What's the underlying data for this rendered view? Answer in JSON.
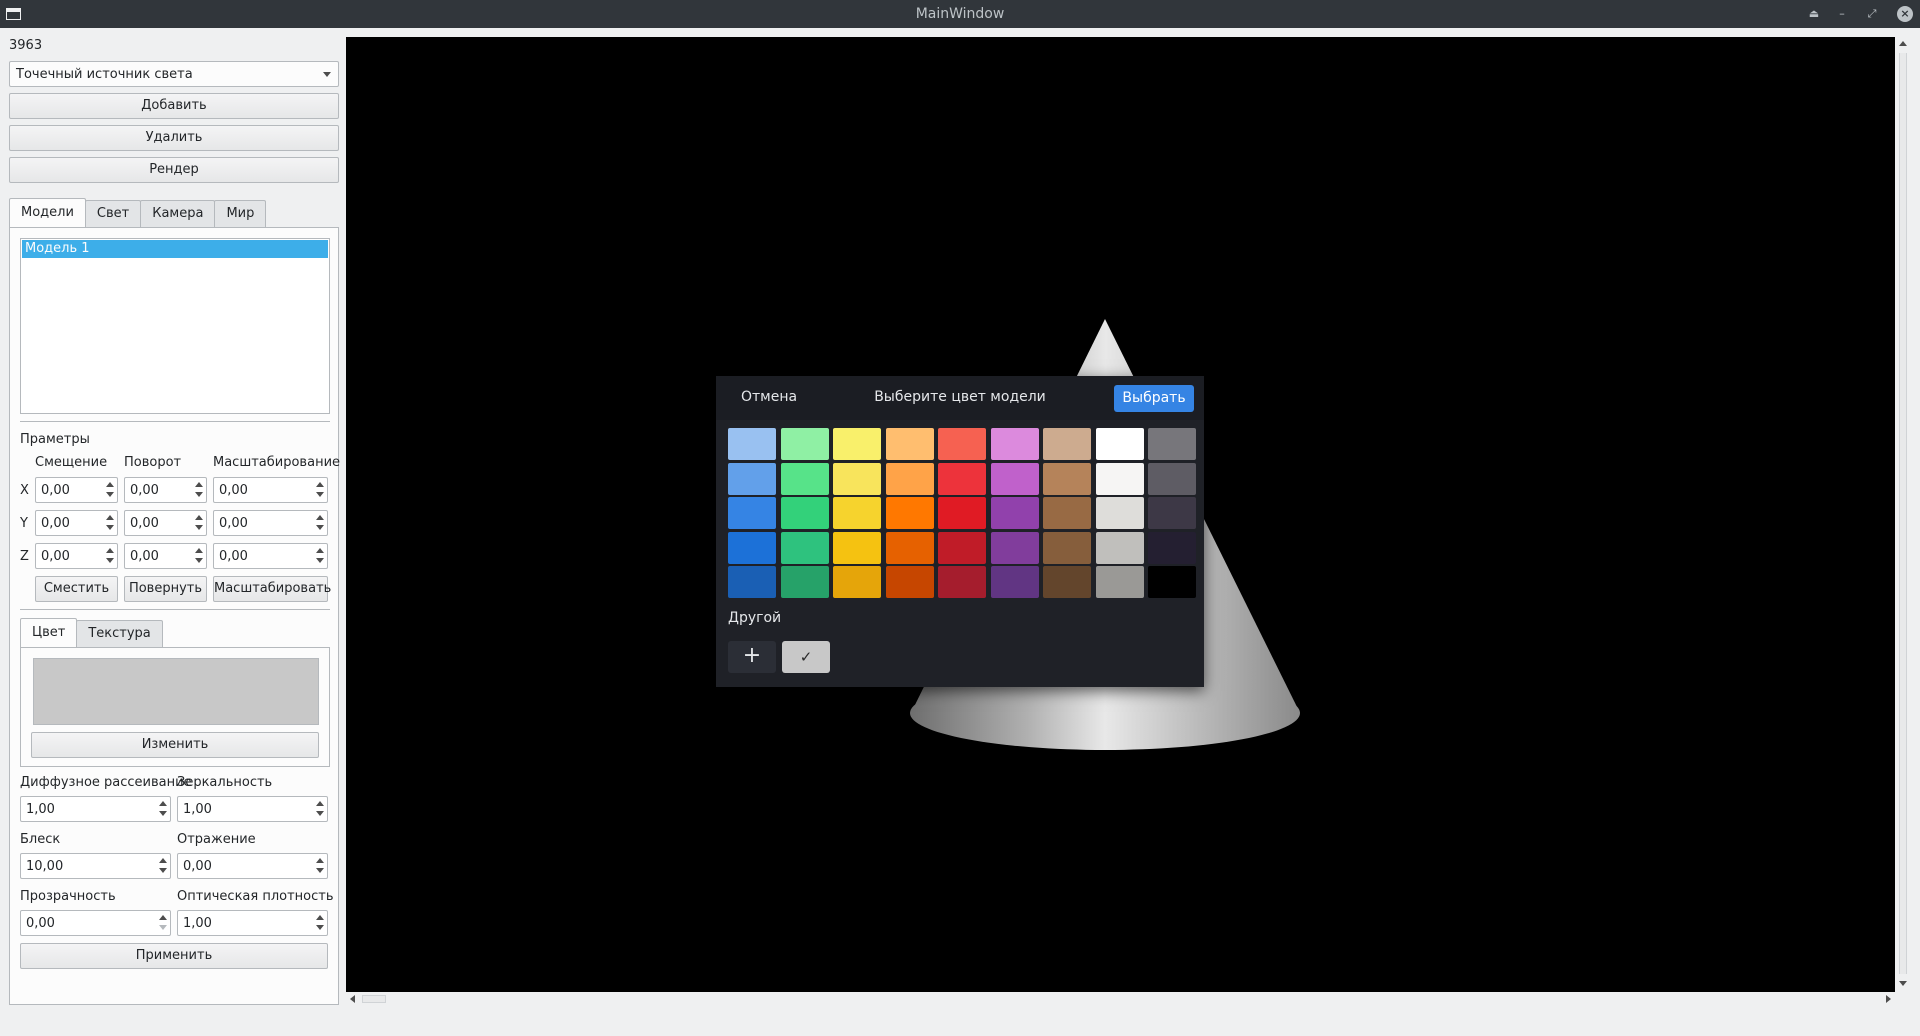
{
  "window": {
    "title": "MainWindow"
  },
  "left": {
    "counter": "3963",
    "light_type": "Точечный источник света",
    "add_label": "Добавить",
    "delete_label": "Удалить",
    "render_label": "Рендер",
    "tabs": [
      "Модели",
      "Свет",
      "Камера",
      "Мир"
    ],
    "models": [
      "Модель 1"
    ],
    "params_title": "Праметры",
    "col_offset": "Смещение",
    "col_rotate": "Поворот",
    "col_scale": "Масштабирование",
    "axes": [
      "X",
      "Y",
      "Z"
    ],
    "rows": [
      {
        "offset": "0,00",
        "rotate": "0,00",
        "scale": "0,00"
      },
      {
        "offset": "0,00",
        "rotate": "0,00",
        "scale": "0,00"
      },
      {
        "offset": "0,00",
        "rotate": "0,00",
        "scale": "0,00"
      }
    ],
    "move_label": "Сместить",
    "rotate_label": "Повернуть",
    "scale_label": "Масштабировать",
    "color_tabs": [
      "Цвет",
      "Текстура"
    ],
    "current_color": "#c8c8c8",
    "change_label": "Изменить",
    "diffuse_label": "Диффузное рассеивание",
    "diffuse_value": "1,00",
    "specular_label": "Зеркальность",
    "specular_value": "1,00",
    "shine_label": "Блеск",
    "shine_value": "10,00",
    "reflection_label": "Отражение",
    "reflection_value": "0,00",
    "transparency_label": "Прозрачность",
    "transparency_value": "0,00",
    "density_label": "Оптическая плотность",
    "density_value": "1,00",
    "apply_label": "Применить"
  },
  "dialog": {
    "cancel_label": "Отмена",
    "title": "Выберите цвет модели",
    "choose_label": "Выбрать",
    "other_label": "Другой",
    "add_icon": "plus-icon",
    "custom_icon": "checkmark-icon",
    "custom_color": "#c8c8c8",
    "palette": [
      [
        "#99c1f1",
        "#8ff0a4",
        "#f9f06b",
        "#ffbe6f",
        "#f66151",
        "#dc8add",
        "#cdab8f",
        "#ffffff",
        "#77767b"
      ],
      [
        "#62a0ea",
        "#57e389",
        "#f8e45c",
        "#ffa348",
        "#ed333b",
        "#c061cb",
        "#b5835a",
        "#f6f5f4",
        "#5e5c64"
      ],
      [
        "#3584e4",
        "#33d17a",
        "#f6d32d",
        "#ff7800",
        "#e01b24",
        "#9141ac",
        "#986a44",
        "#deddda",
        "#3d3846"
      ],
      [
        "#1c71d8",
        "#2ec27e",
        "#f5c211",
        "#e66100",
        "#c01c28",
        "#813d9c",
        "#865e3c",
        "#c0bfbc",
        "#241f31"
      ],
      [
        "#1a5fb4",
        "#26a269",
        "#e5a50a",
        "#c64600",
        "#a51d2d",
        "#613583",
        "#63452c",
        "#9a9996",
        "#000000"
      ]
    ]
  }
}
